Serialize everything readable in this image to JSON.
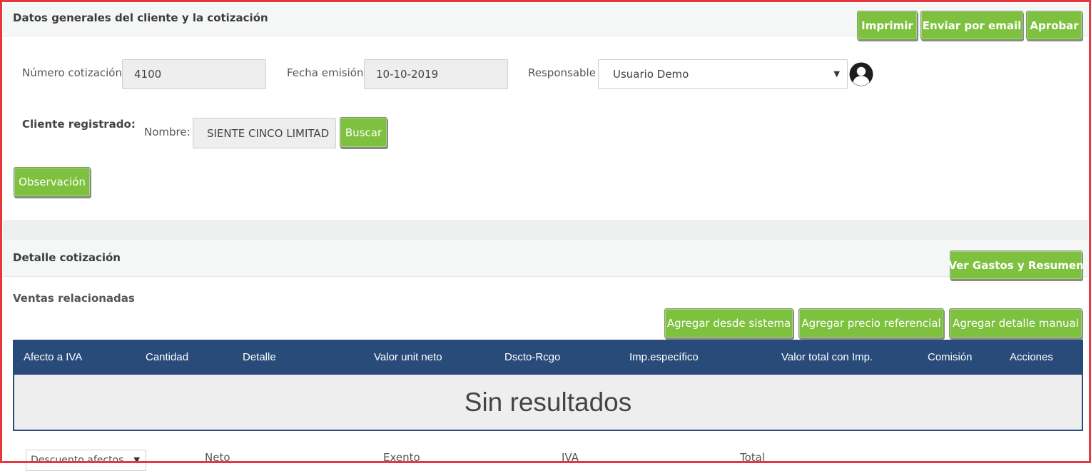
{
  "general": {
    "title": "Datos generales del cliente y la cotización",
    "print_label": "Imprimir",
    "email_label": "Enviar por email",
    "approve_label": "Aprobar",
    "quote_number_label": "Número cotización",
    "quote_number_value": "4100",
    "issue_date_label": "Fecha emisión",
    "issue_date_value": "10-10-2019",
    "responsible_label": "Responsable",
    "responsible_value": "Usuario Demo",
    "registered_client_label": "Cliente registrado:",
    "name_label": "Nombre:",
    "name_value": "SIENTE CINCO LIMITAD",
    "search_label": "Buscar",
    "observation_label": "Observación"
  },
  "detail": {
    "title": "Detalle cotización",
    "expenses_label": "Ver Gastos y Resumen",
    "related_sales_label": "Ventas relacionadas",
    "add_system_label": "Agregar desde sistema",
    "add_reference_label": "Agregar precio referencial",
    "add_manual_label": "Agregar detalle manual",
    "columns": [
      "Afecto a IVA",
      "Cantidad",
      "Detalle",
      "Valor unit neto",
      "Dscto-Rcgo",
      "Imp.específico",
      "Valor total con Imp.",
      "Comisión",
      "Acciones"
    ],
    "empty_text": "Sin resultados"
  },
  "footer": {
    "discount_select": "Descuento afectos",
    "neto_label": "Neto",
    "exento_label": "Exento",
    "iva_label": "IVA",
    "total_label": "Total"
  },
  "colors": {
    "accent_green": "#7dc13f",
    "table_header": "#294b7a",
    "frame_red": "#e8363c"
  },
  "icons": [
    "user-avatar-icon",
    "dropdown-caret-icon"
  ]
}
